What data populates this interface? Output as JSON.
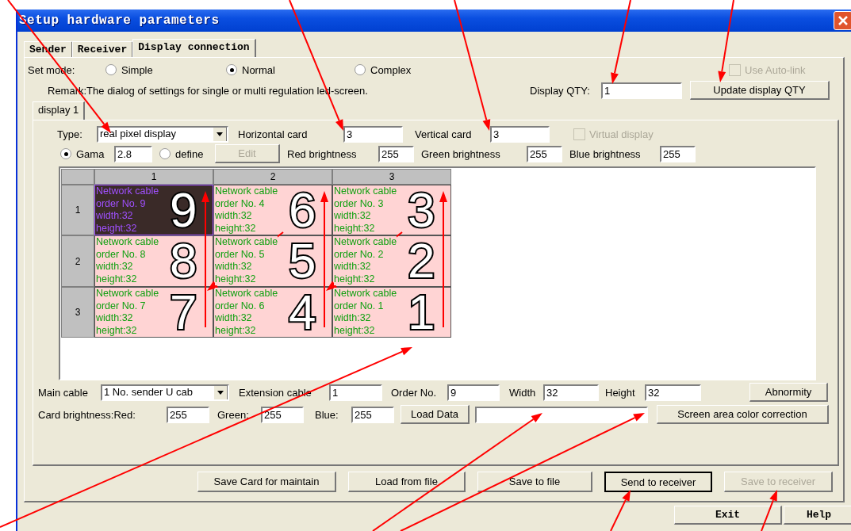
{
  "window": {
    "title": "Setup hardware parameters"
  },
  "tabs": [
    {
      "label": "Sender",
      "selected": false
    },
    {
      "label": "Receiver",
      "selected": false
    },
    {
      "label": "Display connection",
      "selected": true
    }
  ],
  "set_mode": {
    "label": "Set mode:",
    "options": [
      {
        "label": "Simple",
        "selected": false
      },
      {
        "label": "Normal",
        "selected": true
      },
      {
        "label": "Complex",
        "selected": false
      }
    ]
  },
  "auto_link": {
    "label": "Use Auto-link",
    "checked": false,
    "disabled": true
  },
  "remark": "Remark:The dialog of settings for single or multi  regulation led-screen.",
  "display_qty": {
    "label": "Display QTY:",
    "value": "1"
  },
  "update_button": "Update display QTY",
  "display_tabs": [
    {
      "label": "display 1",
      "selected": true
    }
  ],
  "type": {
    "label": "Type:",
    "value": "real pixel display"
  },
  "horizontal_card": {
    "label": "Horizontal card",
    "value": "3"
  },
  "vertical_card": {
    "label": "Vertical card",
    "value": "3"
  },
  "virtual_display": {
    "label": "Virtual display",
    "checked": false,
    "disabled": true
  },
  "gamma": {
    "label": "Gama",
    "selected": true,
    "value": "2.8"
  },
  "define": {
    "label": "define",
    "selected": false
  },
  "edit_button": {
    "label": "Edit",
    "disabled": true
  },
  "brightness": [
    {
      "label": "Red brightness",
      "value": "255"
    },
    {
      "label": "Green brightness",
      "value": "255"
    },
    {
      "label": "Blue brightness",
      "value": "255"
    }
  ],
  "grid": {
    "columns": [
      "1",
      "2",
      "3"
    ],
    "rows": [
      {
        "header": "1",
        "cells": [
          {
            "lines": [
              "Network cable",
              "order No. 9",
              "width:32",
              "height:32"
            ],
            "selected": true,
            "annotation": "9"
          },
          {
            "lines": [
              "Network cable",
              "order No. 4",
              "width:32",
              "height:32"
            ],
            "selected": false,
            "annotation": "6"
          },
          {
            "lines": [
              "Network cable",
              "order No. 3",
              "width:32",
              "height:32"
            ],
            "selected": false,
            "annotation": "3"
          }
        ]
      },
      {
        "header": "2",
        "cells": [
          {
            "lines": [
              "Network cable",
              "order No. 8",
              "width:32",
              "height:32"
            ],
            "selected": false,
            "annotation": "8"
          },
          {
            "lines": [
              "Network cable",
              "order No. 5",
              "width:32",
              "height:32"
            ],
            "selected": false,
            "annotation": "5"
          },
          {
            "lines": [
              "Network cable",
              "order No. 2",
              "width:32",
              "height:32"
            ],
            "selected": false,
            "annotation": "2"
          }
        ]
      },
      {
        "header": "3",
        "cells": [
          {
            "lines": [
              "Network cable",
              "order No. 7",
              "width:32",
              "height:32"
            ],
            "selected": false,
            "annotation": "7"
          },
          {
            "lines": [
              "Network cable",
              "order No. 6",
              "width:32",
              "height:32"
            ],
            "selected": false,
            "annotation": "4"
          },
          {
            "lines": [
              "Network cable",
              "order No. 1",
              "width:32",
              "height:32"
            ],
            "selected": false,
            "annotation": "1"
          }
        ]
      }
    ]
  },
  "main_cable": {
    "label": "Main cable",
    "value": "1 No. sender U cab"
  },
  "extension_cable": {
    "label": "Extension cable",
    "value": "1"
  },
  "order_no": {
    "label": "Order No.",
    "value": "9"
  },
  "width": {
    "label": "Width",
    "value": "32"
  },
  "height": {
    "label": "Height",
    "value": "32"
  },
  "abnormity_button": "Abnormity",
  "card_brightness": [
    {
      "label": "Card brightness:Red:",
      "value": "255"
    },
    {
      "label": "Green:",
      "value": "255"
    },
    {
      "label": "Blue:",
      "value": "255"
    }
  ],
  "load_data_button": "Load Data",
  "color_correction_button": "Screen area color correction",
  "actions": [
    {
      "label": "Save Card for maintain",
      "disabled": false,
      "default": false
    },
    {
      "label": "Load from file",
      "disabled": false,
      "default": false
    },
    {
      "label": "Save to file",
      "disabled": false,
      "default": false
    },
    {
      "label": "Send to receiver",
      "disabled": false,
      "default": true
    },
    {
      "label": "Save to receiver",
      "disabled": true,
      "default": false
    }
  ],
  "footer_buttons": [
    "Exit",
    "Help"
  ]
}
